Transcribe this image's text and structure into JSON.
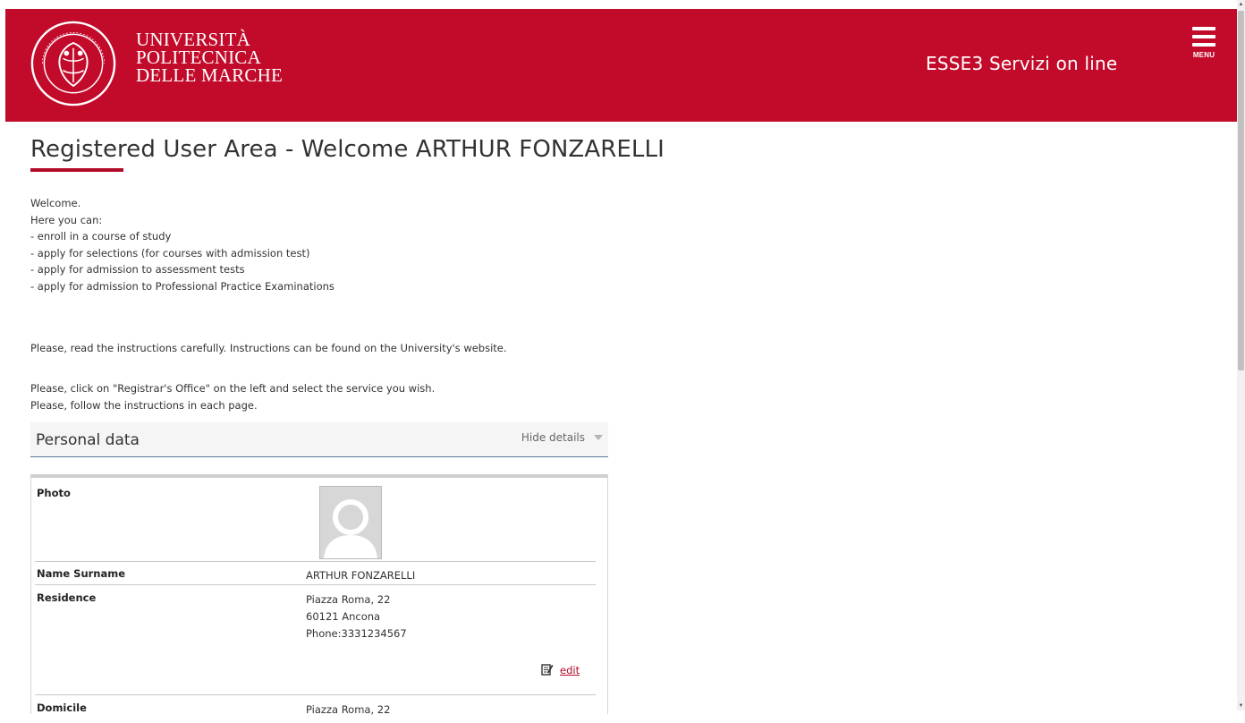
{
  "header": {
    "logo_lines": [
      "UNIVERSITÀ",
      "POLITECNICA",
      "DELLE MARCHE"
    ],
    "service_title": "ESSE3 Servizi on line",
    "menu_label": "MENU",
    "brand_color": "#c20b2b"
  },
  "page": {
    "title": "Registered User Area - Welcome ARTHUR FONZARELLI",
    "intro_lines": [
      "Welcome.",
      "Here you can:",
      "- enroll in a course of study",
      "- apply for selections (for courses with admission test)",
      "- apply for admission to assessment tests",
      "- apply for admission to Professional Practice Examinations"
    ],
    "instructions_1": "Please, read the instructions carefully. Instructions can be found on the University's website.",
    "instructions_2_lines": [
      "Please, click on \"Registrar's Office\" on the left and select the service you wish.",
      "Please, follow the instructions in each page."
    ]
  },
  "personal_data": {
    "section_title": "Personal data",
    "hide_details_label": "Hide details",
    "rows": {
      "photo": {
        "label": "Photo"
      },
      "name": {
        "label": "Name Surname",
        "value": "ARTHUR FONZARELLI"
      },
      "residence": {
        "label": "Residence",
        "lines": [
          "Piazza Roma, 22",
          "60121 Ancona",
          "Phone:3331234567"
        ],
        "edit_label": "edit"
      },
      "domicile": {
        "label": "Domicile",
        "lines": [
          "Piazza Roma, 22"
        ]
      }
    }
  }
}
